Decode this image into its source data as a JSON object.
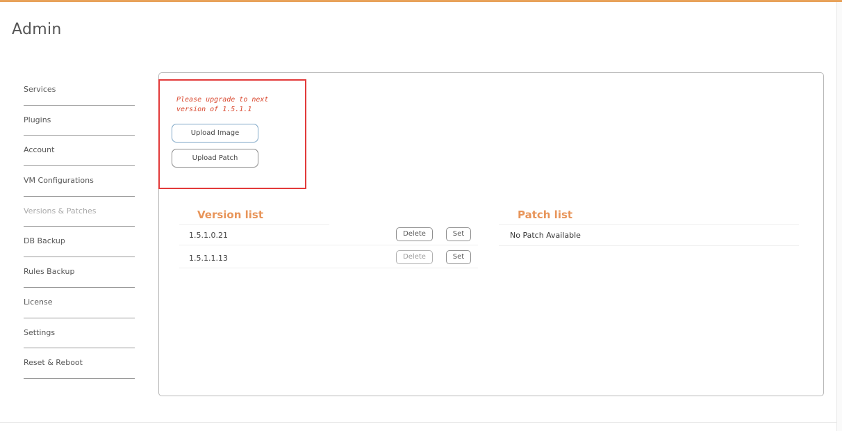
{
  "page": {
    "title": "Admin"
  },
  "sidebar": {
    "items": [
      {
        "label": "Services",
        "active": false
      },
      {
        "label": "Plugins",
        "active": false
      },
      {
        "label": "Account",
        "active": false
      },
      {
        "label": "VM Configurations",
        "active": false
      },
      {
        "label": "Versions & Patches",
        "active": true
      },
      {
        "label": "DB Backup",
        "active": false
      },
      {
        "label": "Rules Backup",
        "active": false
      },
      {
        "label": "License",
        "active": false
      },
      {
        "label": "Settings",
        "active": false
      },
      {
        "label": "Reset & Reboot",
        "active": false
      }
    ]
  },
  "upgrade": {
    "notice": "Please upgrade to next version of 1.5.1.1",
    "upload_image_label": "Upload Image",
    "upload_patch_label": "Upload Patch",
    "highlight_color": "#e23a3a"
  },
  "versions": {
    "heading": "Version list",
    "rows": [
      {
        "version": "1.5.1.0.21",
        "delete_label": "Delete",
        "delete_enabled": true,
        "set_label": "Set"
      },
      {
        "version": "1.5.1.1.13",
        "delete_label": "Delete",
        "delete_enabled": false,
        "set_label": "Set"
      }
    ]
  },
  "patches": {
    "heading": "Patch list",
    "empty_text": "No Patch Available"
  },
  "colors": {
    "accent": "#e8955a",
    "top_bar": "#e8a25a",
    "notice_text": "#d9482f"
  }
}
